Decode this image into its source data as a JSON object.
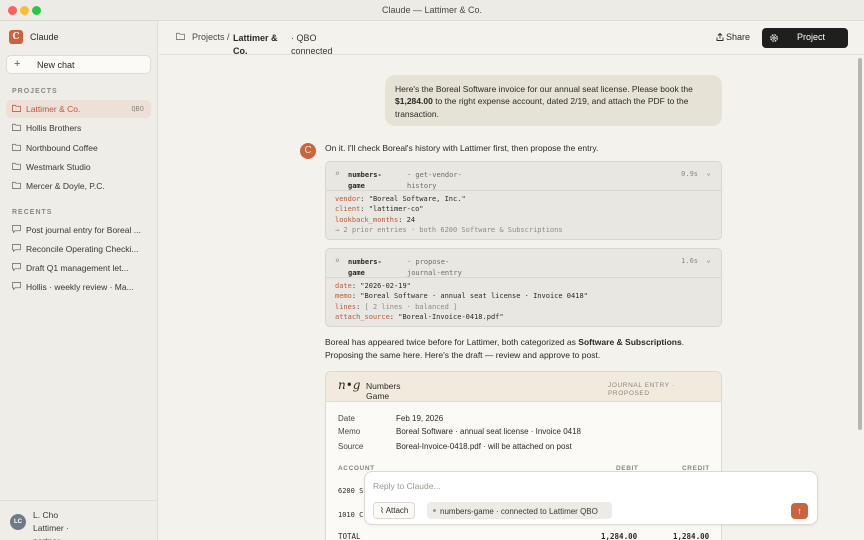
{
  "window": {
    "title": "Claude — Lattimer & Co."
  },
  "sidebar": {
    "brand": "Claude",
    "logo_letter": "C",
    "new_chat_label": "New chat",
    "projects_heading": "PROJECTS",
    "projects": [
      {
        "label": "Lattimer & Co.",
        "badge": "QBO",
        "active": true
      },
      {
        "label": "Hollis Brothers"
      },
      {
        "label": "Northbound Coffee"
      },
      {
        "label": "Westmark Studio"
      },
      {
        "label": "Mercer & Doyle, P.C."
      }
    ],
    "recents_heading": "RECENTS",
    "recents": [
      {
        "label": "Post journal entry for Boreal ..."
      },
      {
        "label": "Reconcile Operating Checki..."
      },
      {
        "label": "Draft Q1 management let..."
      },
      {
        "label": "Hollis · weekly review · Ma..."
      }
    ],
    "user": {
      "initials": "LC",
      "name": "L. Cho Lattimer · partner"
    }
  },
  "header": {
    "crumb_projects": "Projects /",
    "crumb_current": "Lattimer & Co.",
    "crumb_status": "· QBO connected",
    "share_label": "Share",
    "project_button_label": "Project"
  },
  "conversation": {
    "user_message": {
      "before": "Here's the Boreal Software invoice for our annual seat license. Please book the",
      "amount": "$1,284.00",
      "after": "to the right expense account, dated 2/19, and attach the PDF to the transaction."
    },
    "assistant_avatar": "C",
    "assistant_intro": "On it. I'll check Boreal's history with Lattimer first, then propose the entry.",
    "tool_calls": [
      {
        "server": "numbers-game",
        "call": "· get-vendor-history",
        "time": "0.9s",
        "args": [
          {
            "key": "vendor",
            "value": "\"Boreal Software, Inc.\""
          },
          {
            "key": "client",
            "value": "\"lattimer-co\""
          },
          {
            "key": "lookback_months",
            "value": "24"
          }
        ],
        "result": "→ 2 prior entries · both 6200 Software & Subscriptions"
      },
      {
        "server": "numbers-game",
        "call": "· propose-journal-entry",
        "time": "1.6s",
        "args": [
          {
            "key": "date",
            "value": "\"2026-02-19\""
          },
          {
            "key": "memo",
            "value": "\"Boreal Software · annual seat license · Invoice 0418\""
          },
          {
            "key": "lines",
            "value": "[ 2 lines · balanced ]"
          },
          {
            "key": "attach_source",
            "value": "\"Boreal-Invoice-0418.pdf\""
          }
        ]
      }
    ],
    "summary": {
      "before": "Boreal has appeared twice before for Lattimer, both categorized as",
      "category": "Software & Subscriptions",
      "after": ".",
      "line2": "Proposing the same here. Here's the draft — review and approve to post."
    },
    "journal_card": {
      "logo": "n•g",
      "title": "Numbers Game",
      "status": "JOURNAL ENTRY · PROPOSED",
      "fields": [
        {
          "label": "Date",
          "value": "Feb 19, 2026"
        },
        {
          "label": "Memo",
          "value": "Boreal Software · annual seat license · Invoice 0418"
        },
        {
          "label": "Source",
          "value": "Boreal-Invoice-0418.pdf · will be attached on post"
        }
      ],
      "columns": {
        "account": "ACCOUNT",
        "debit": "DEBIT",
        "credit": "CREDIT"
      },
      "lines": [
        {
          "account": "6200 S"
        },
        {
          "account": "1010 C"
        }
      ],
      "total": {
        "label": "TOTAL",
        "debit": "1,284.00",
        "credit": "1,284.00"
      }
    }
  },
  "composer": {
    "placeholder": "Reply to Claude...",
    "attach_label": "Attach",
    "connection_label": "numbers-game · connected to Lattimer QBO",
    "send_icon": "arrow-up-icon"
  },
  "colors": {
    "accent": "#c9643f",
    "sidebar_bg": "#efede7",
    "main_bg": "#f4f2ec",
    "bubble_bg": "#e6e2d5"
  }
}
